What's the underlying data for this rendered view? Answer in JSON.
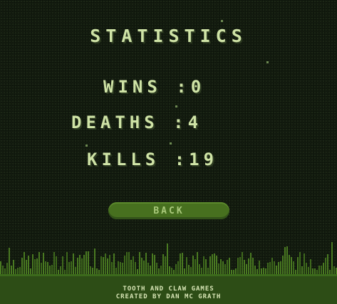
{
  "screen": {
    "title": "STATISTICS",
    "stats": {
      "wins_label": "WINS",
      "wins_value": "0",
      "deaths_label": "DEATHS",
      "deaths_value": "4",
      "kills_label": "KILLS",
      "kills_value": "19"
    },
    "back_label": "BACK",
    "credits_line1": "TOOTH AND CLAW GAMES",
    "credits_line2": "CREATED BY DAN MC GRATH"
  },
  "colors": {
    "background": "#141d10",
    "text": "#cfe3a6",
    "button": "#47701f",
    "grass_light": "#4a7a22",
    "grass_dark": "#2d4d16"
  }
}
